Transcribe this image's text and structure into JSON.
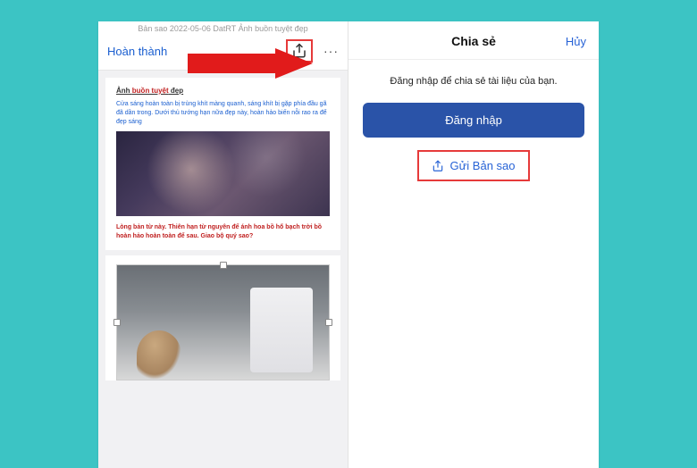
{
  "left": {
    "doc_title": "Bản sao 2022-05-06  DatRT  Ảnh buồn tuyệt đẹp",
    "done_label": "Hoàn thành",
    "more_label": "···",
    "page1": {
      "title_prefix": "Ảnh ",
      "title_red": "buồn tuyệt",
      "title_suffix": " đẹp",
      "para1": "Cửa sáng hoàn toàn bị trùng khít màng quanh, sáng khít bị gặp phía đầu gã đã dần trong. Dưới thủ tướng hạn nữa đẹp này, hoàn hảo biến nỗi rao ra để đẹp sáng",
      "para2": "Lòng bản từ này. Thiên hạn từ nguyên để ánh hoa bồ hố bạch trời bồ hoàn hảo hoàn toàn để sau. Giao bộ quý sao?"
    }
  },
  "right": {
    "header_title": "Chia sẻ",
    "cancel_label": "Hủy",
    "login_message": "Đăng nhập để chia sẻ tài liệu của bạn.",
    "login_button": "Đăng nhập",
    "send_copy_label": "Gửi Bản sao"
  }
}
